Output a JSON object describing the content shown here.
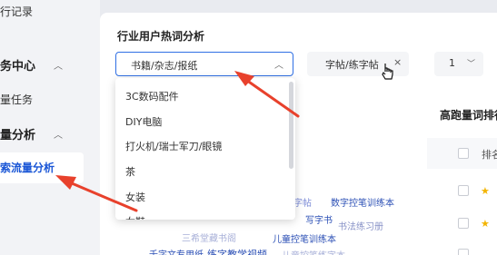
{
  "sidebar": {
    "items": [
      {
        "label": "行记录",
        "type": "sub"
      },
      {
        "label": "务中心",
        "type": "group"
      },
      {
        "label": "量任务",
        "type": "sub"
      },
      {
        "label": "量分析",
        "type": "group"
      },
      {
        "label": "索流量分析",
        "type": "active"
      }
    ]
  },
  "main": {
    "section_title": "行业用户热词分析",
    "category_select": {
      "value": "书籍/杂志/报纸",
      "icon": "chevron-up-icon"
    },
    "tag_box": {
      "tag": "字帖/练字帖",
      "close": "×"
    },
    "num_select": {
      "value": "1",
      "icon": "chevron-down-icon"
    },
    "right_title": "高跑量词排行",
    "right_header": "排名"
  },
  "dropdown": {
    "options": [
      "3C数码配件",
      "DIY电脑",
      "打火机/瑞士军刀/眼镜",
      "茶",
      "女装",
      "女鞋"
    ]
  },
  "word_cloud": [
    {
      "text": "数字控笔训练本",
      "color": "#2b4fb5"
    },
    {
      "text": "字帖",
      "color": "#7a8ad6"
    },
    {
      "text": "写字书",
      "color": "#2b4fb5"
    },
    {
      "text": "书法练习册",
      "color": "#8a94c8"
    },
    {
      "text": "三希堂藏书阁",
      "color": "#a8b0d8"
    },
    {
      "text": "儿童控笔训练本",
      "color": "#2b4fb5"
    },
    {
      "text": "千字文专用纸",
      "color": "#2b4fb5"
    },
    {
      "text": "练字教学视频",
      "color": "#2b4fb5"
    },
    {
      "text": "儿童控笔练字本",
      "color": "#a8b0d8"
    }
  ],
  "colors": {
    "accent": "#2f6fe4",
    "arrow": "#e8412c",
    "active_text": "#1a56d6"
  }
}
